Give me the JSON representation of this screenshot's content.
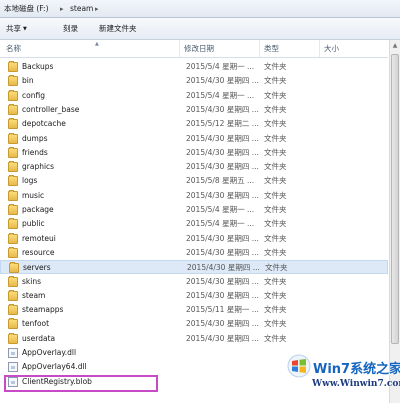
{
  "address": {
    "drive": "本地磁盘 (F:)",
    "sep": "▸",
    "folder": "steam"
  },
  "toolbar": {
    "share_label": "共享",
    "burn_label": "刻录",
    "newfolder_label": "新建文件夹",
    "share_arrow": "▼"
  },
  "columns": {
    "name": "名称",
    "date": "修改日期",
    "type": "类型",
    "size": "大小",
    "sort_indicator": "▲"
  },
  "files": [
    {
      "name": "Backups",
      "date": "2015/5/4 星期一 ...",
      "type": "文件夹",
      "kind": "folder"
    },
    {
      "name": "bin",
      "date": "2015/4/30 星期四 ...",
      "type": "文件夹",
      "kind": "folder"
    },
    {
      "name": "config",
      "date": "2015/5/4 星期一 ...",
      "type": "文件夹",
      "kind": "folder"
    },
    {
      "name": "controller_base",
      "date": "2015/4/30 星期四 ...",
      "type": "文件夹",
      "kind": "folder"
    },
    {
      "name": "depotcache",
      "date": "2015/5/12 星期二 ...",
      "type": "文件夹",
      "kind": "folder"
    },
    {
      "name": "dumps",
      "date": "2015/4/30 星期四 ...",
      "type": "文件夹",
      "kind": "folder"
    },
    {
      "name": "friends",
      "date": "2015/4/30 星期四 ...",
      "type": "文件夹",
      "kind": "folder"
    },
    {
      "name": "graphics",
      "date": "2015/4/30 星期四 ...",
      "type": "文件夹",
      "kind": "folder"
    },
    {
      "name": "logs",
      "date": "2015/5/8 星期五 ...",
      "type": "文件夹",
      "kind": "folder"
    },
    {
      "name": "music",
      "date": "2015/4/30 星期四 ...",
      "type": "文件夹",
      "kind": "folder"
    },
    {
      "name": "package",
      "date": "2015/5/4 星期一 ...",
      "type": "文件夹",
      "kind": "folder"
    },
    {
      "name": "public",
      "date": "2015/5/4 星期一 ...",
      "type": "文件夹",
      "kind": "folder"
    },
    {
      "name": "remoteui",
      "date": "2015/4/30 星期四 ...",
      "type": "文件夹",
      "kind": "folder"
    },
    {
      "name": "resource",
      "date": "2015/4/30 星期四 ...",
      "type": "文件夹",
      "kind": "folder"
    },
    {
      "name": "servers",
      "date": "2015/4/30 星期四 ...",
      "type": "文件夹",
      "kind": "folder",
      "selected": true
    },
    {
      "name": "skins",
      "date": "2015/4/30 星期四 ...",
      "type": "文件夹",
      "kind": "folder"
    },
    {
      "name": "steam",
      "date": "2015/4/30 星期四 ...",
      "type": "文件夹",
      "kind": "folder"
    },
    {
      "name": "steamapps",
      "date": "2015/5/11 星期一 ...",
      "type": "文件夹",
      "kind": "folder"
    },
    {
      "name": "tenfoot",
      "date": "2015/4/30 星期四 ...",
      "type": "文件夹",
      "kind": "folder"
    },
    {
      "name": "userdata",
      "date": "2015/4/30 星期四 ...",
      "type": "文件夹",
      "kind": "folder"
    },
    {
      "name": "AppOverlay.dll",
      "date": "",
      "type": "",
      "kind": "file"
    },
    {
      "name": "AppOverlay64.dll",
      "date": "",
      "type": "",
      "kind": "file"
    },
    {
      "name": "ClientRegistry.blob",
      "date": "",
      "type": "",
      "kind": "file"
    }
  ],
  "watermark": {
    "title": "Win7系统之家",
    "url": "Www.Winwin7.com"
  },
  "colors": {
    "folder": "#e8b94a",
    "selection": "#dde9f7",
    "highlight_box": "#c74bc7",
    "watermark_blue": "#1565c0"
  }
}
